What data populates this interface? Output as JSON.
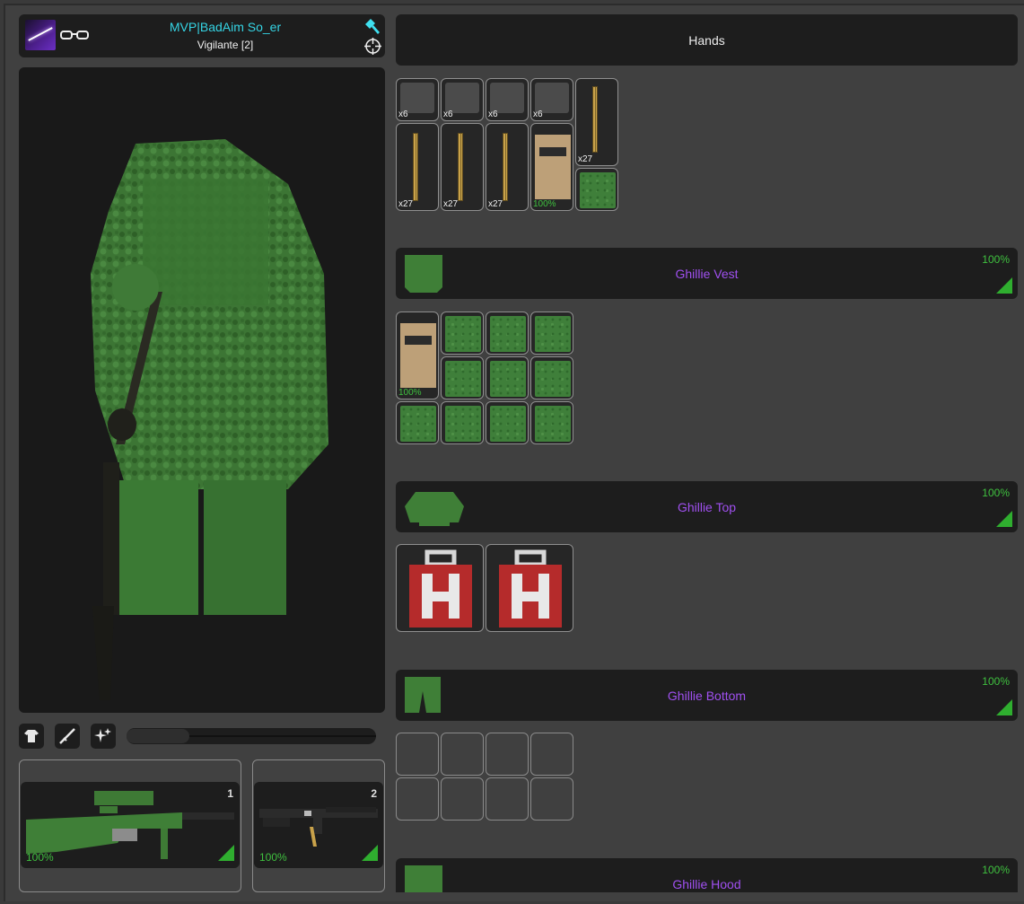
{
  "player": {
    "name": "MVP|BadAim So_er",
    "group": "Vigilante [2]"
  },
  "hands": {
    "label": "Hands"
  },
  "hands_slots": [
    {
      "count": "x6"
    },
    {
      "count": "x6"
    },
    {
      "count": "x6"
    },
    {
      "count": "x6"
    },
    {
      "count": "x27"
    },
    {
      "count": "x27"
    },
    {
      "count": "x27"
    },
    {
      "count": "x27"
    },
    {
      "quality": "100%"
    }
  ],
  "clothing": [
    {
      "name": "Ghillie Vest",
      "quality": "100%",
      "icon": "ghillie-vest-icon"
    },
    {
      "name": "Ghillie Top",
      "quality": "100%",
      "icon": "ghillie-top-icon"
    },
    {
      "name": "Ghillie Bottom",
      "quality": "100%",
      "icon": "ghillie-bottom-icon"
    },
    {
      "name": "Ghillie Hood",
      "quality": "100%",
      "icon": "ghillie-hood-icon"
    }
  ],
  "vest_slots": {
    "armor_quality": "100%"
  },
  "weapons": [
    {
      "slot": "1",
      "quality": "100%",
      "icon": "sniper-rifle-icon"
    },
    {
      "slot": "2",
      "quality": "100%",
      "icon": "assault-rifle-icon"
    }
  ],
  "view_controls": {
    "zoom": 0.25,
    "icons": [
      "shirt-icon",
      "rifle-icon",
      "sparkle-icon"
    ]
  },
  "colors": {
    "name": "#35d4e4",
    "item_name": "#a050f0",
    "quality": "#3fc03f",
    "panel": "#1d1d1d",
    "background": "#404040"
  }
}
